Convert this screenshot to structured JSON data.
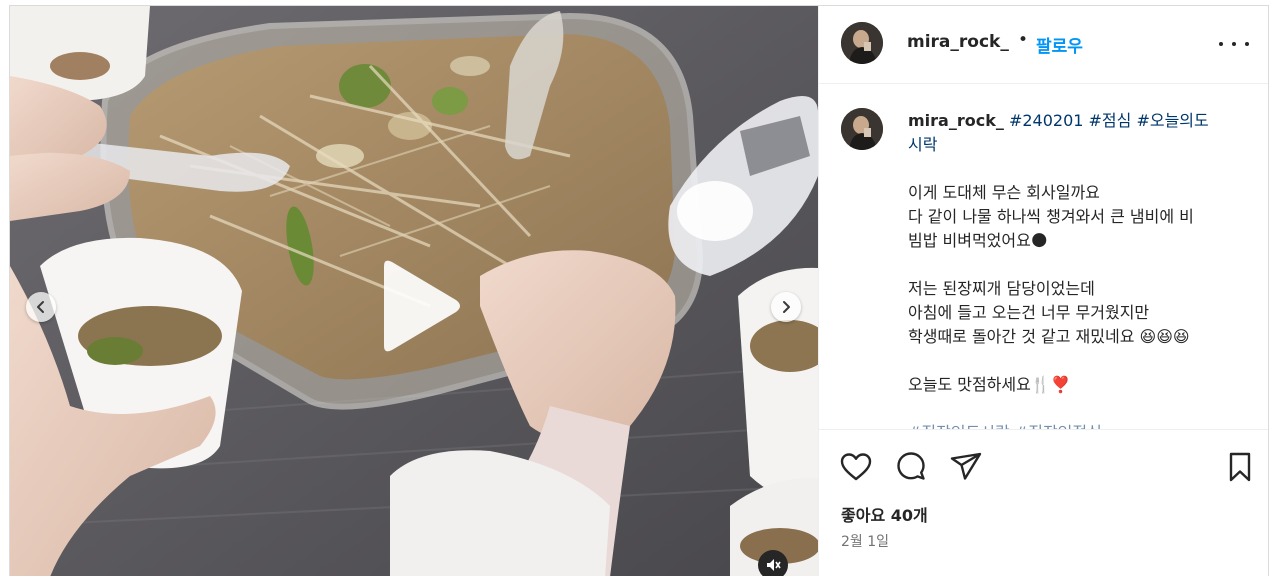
{
  "post": {
    "username": "mira_rock_",
    "separator": "•",
    "follow_label": "팔로우"
  },
  "caption": {
    "username": "mira_rock_",
    "tags_line1": "#240201 #점심 #오늘의도",
    "tags_line2": "시락",
    "para1": [
      "이게 도대체 무슨 회사일까요",
      "다 같이 나물 하나씩 챙겨와서 큰 냄비에 비",
      "빔밥 비벼먹었어요🌑"
    ],
    "para2": [
      "저는 된장찌개 담당이었는데",
      "아침에 들고 오는건 너무 무거웠지만",
      "학생때로 돌아간 것 같고 재밌네요 😆😆😆"
    ],
    "para3": "오늘도 맛점하세요🍴❣️",
    "trailing_tags": "#직장인도시락 #직장인점심"
  },
  "engagement": {
    "likes_label": "좋아요 40개",
    "date_label": "2월 1일"
  },
  "icons": {
    "like": "heart-outline-icon",
    "comment": "speech-bubble-icon",
    "share": "paper-plane-icon",
    "save": "bookmark-icon",
    "more": "ellipsis-icon",
    "play": "play-icon",
    "mute": "speaker-muted-icon"
  },
  "colors": {
    "accent": "#0095f6",
    "hashtag": "#00376b",
    "text": "#262626",
    "secondary": "#737373"
  }
}
